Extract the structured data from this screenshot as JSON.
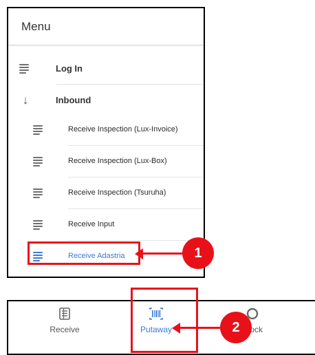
{
  "menu": {
    "title": "Menu",
    "items": [
      {
        "label": "Log In",
        "icon": "menu-lines-icon"
      },
      {
        "label": "Inbound",
        "icon": "arrow-down-icon"
      }
    ],
    "subitems": [
      {
        "label": "Receive Inspection (Lux-Invoice)",
        "icon": "menu-lines-icon"
      },
      {
        "label": "Receive Inspection (Lux-Box)",
        "icon": "menu-lines-icon"
      },
      {
        "label": "Receive Inspection (Tsuruha)",
        "icon": "menu-lines-icon"
      },
      {
        "label": "Receive Input",
        "icon": "menu-lines-icon"
      },
      {
        "label": "Receive Adastria",
        "icon": "menu-lines-icon",
        "selected": true
      }
    ]
  },
  "tabs": [
    {
      "label": "Receive",
      "icon": "document-list-icon"
    },
    {
      "label": "Putaway",
      "icon": "barcode-icon",
      "selected": true
    },
    {
      "label": "Stock",
      "icon": "stock-icon"
    }
  ],
  "callouts": [
    {
      "number": "1",
      "target": "Receive Adastria"
    },
    {
      "number": "2",
      "target": "Putaway"
    }
  ],
  "colors": {
    "callout": "#e8111a",
    "accent": "#3a7bd5",
    "frame": "#000000"
  }
}
